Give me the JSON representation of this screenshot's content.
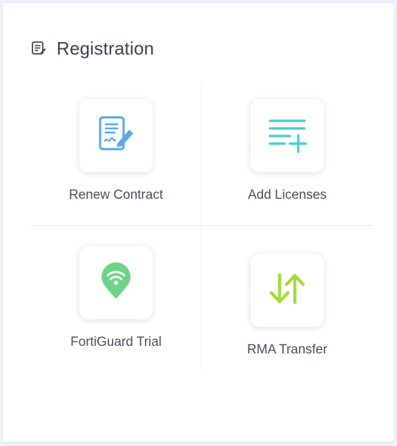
{
  "panel": {
    "title": "Registration",
    "title_icon": "registration-form-icon"
  },
  "tiles": [
    {
      "label": "Renew Contract",
      "icon": "contract-edit-icon",
      "color": "#57a9e8"
    },
    {
      "label": "Add Licenses",
      "icon": "list-add-icon",
      "color": "#4ccbd8"
    },
    {
      "label": "FortiGuard Trial",
      "icon": "location-wifi-icon",
      "color": "#6fd48a"
    },
    {
      "label": "RMA Transfer",
      "icon": "transfer-arrows-icon",
      "color": "#a6d93a"
    }
  ]
}
